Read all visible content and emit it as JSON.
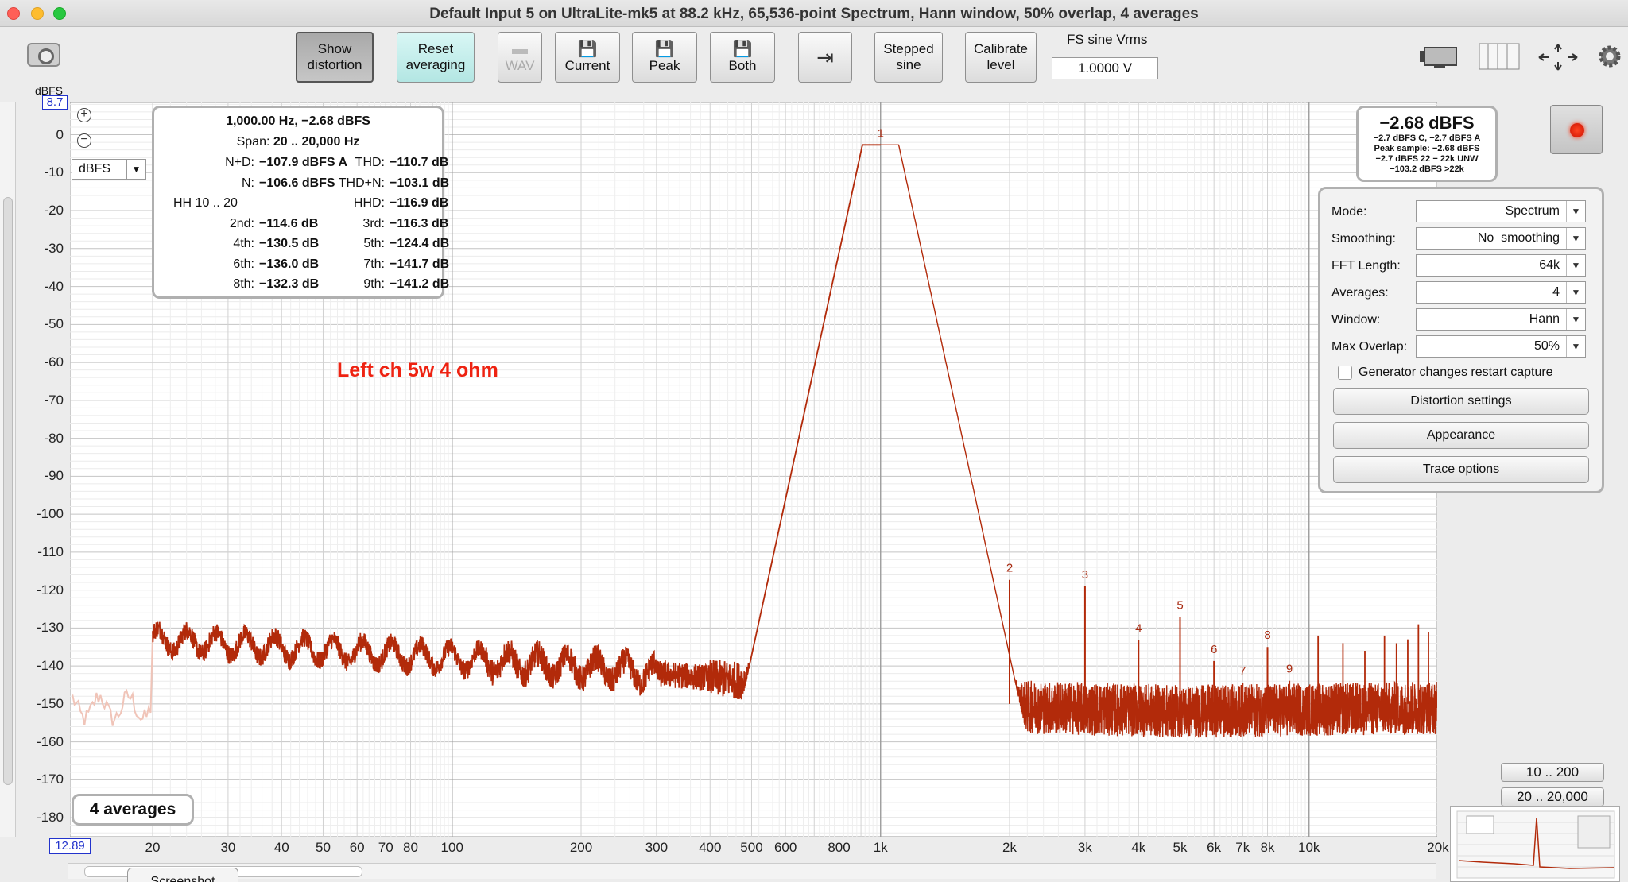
{
  "window": {
    "title": "Default Input 5 on UltraLite-mk5 at 88.2 kHz, 65,536-point Spectrum, Hann window, 50% overlap, 4 averages"
  },
  "toolbar": {
    "show_distortion": [
      "Show",
      "distortion"
    ],
    "reset_averaging": [
      "Reset",
      "averaging"
    ],
    "wav": "WAV",
    "current": "Current",
    "peak": "Peak",
    "both": "Both",
    "stepped_sine": [
      "Stepped",
      "sine"
    ],
    "calibrate_level": [
      "Calibrate",
      "level"
    ],
    "fs_label": "FS sine Vrms",
    "fs_value": "1.0000 V"
  },
  "axis": {
    "y_unit": "dBFS",
    "y_max": "8.7",
    "y_min_label": "12.89",
    "units_select": "dBFS",
    "y_ticks": [
      0,
      -10,
      -20,
      -30,
      -40,
      -50,
      -60,
      -70,
      -80,
      -90,
      -100,
      -110,
      -120,
      -130,
      -140,
      -150,
      -160,
      -170,
      -180
    ],
    "x_ticks": [
      {
        "f": 20,
        "label": "20"
      },
      {
        "f": 30,
        "label": "30"
      },
      {
        "f": 40,
        "label": "40"
      },
      {
        "f": 50,
        "label": "50"
      },
      {
        "f": 60,
        "label": "60"
      },
      {
        "f": 70,
        "label": "70"
      },
      {
        "f": 80,
        "label": "80"
      },
      {
        "f": 100,
        "label": "100"
      },
      {
        "f": 200,
        "label": "200"
      },
      {
        "f": 300,
        "label": "300"
      },
      {
        "f": 400,
        "label": "400"
      },
      {
        "f": 500,
        "label": "500"
      },
      {
        "f": 600,
        "label": "600"
      },
      {
        "f": 800,
        "label": "800"
      },
      {
        "f": 1000,
        "label": "1k"
      },
      {
        "f": 2000,
        "label": "2k"
      },
      {
        "f": 3000,
        "label": "3k"
      },
      {
        "f": 4000,
        "label": "4k"
      },
      {
        "f": 5000,
        "label": "5k"
      },
      {
        "f": 6000,
        "label": "6k"
      },
      {
        "f": 7000,
        "label": "7k"
      },
      {
        "f": 8000,
        "label": "8k"
      },
      {
        "f": 10000,
        "label": "10k"
      },
      {
        "f": 20000,
        "label": "20k"
      }
    ]
  },
  "distortion": {
    "header1": "1,000.00 Hz, −2.68 dBFS",
    "header2_prefix": "Span: ",
    "header2_value": "20 .. 20,000 Hz",
    "rows": [
      {
        "l_label": "N+D:",
        "l_value": "−107.9 dBFS A",
        "r_label": "THD:",
        "r_value": "−110.7 dB"
      },
      {
        "l_label": "N:",
        "l_value": "−106.6 dBFS",
        "r_label": "THD+N:",
        "r_value": "−103.1 dB"
      },
      {
        "l_label": "HH 10 .. 20",
        "l_value": "",
        "r_label": "HHD:",
        "r_value": "−116.9 dB"
      },
      {
        "l_label": "2nd:",
        "l_value": "−114.6 dB",
        "r_label": "3rd:",
        "r_value": "−116.3 dB"
      },
      {
        "l_label": "4th:",
        "l_value": "−130.5 dB",
        "r_label": "5th:",
        "r_value": "−124.4 dB"
      },
      {
        "l_label": "6th:",
        "l_value": "−136.0 dB",
        "r_label": "7th:",
        "r_value": "−141.7 dB"
      },
      {
        "l_label": "8th:",
        "l_value": "−132.3 dB",
        "r_label": "9th:",
        "r_value": "−141.2 dB"
      }
    ]
  },
  "annotation": "Left ch 5w 4 ohm",
  "level": {
    "big": "−2.68 dBFS",
    "lines": [
      "−2.7 dBFS C, −2.7 dBFS A",
      "Peak sample: −2.68 dBFS",
      "−2.7 dBFS 22 − 22k UNW",
      "−103.2 dBFS >22k"
    ]
  },
  "settings": {
    "mode_label": "Mode:",
    "mode_value": "Spectrum",
    "smoothing_label": "Smoothing:",
    "smoothing_value": "No  smoothing",
    "fft_label": "FFT Length:",
    "fft_value": "64k",
    "averages_label": "Averages:",
    "averages_value": "4",
    "window_label": "Window:",
    "window_value": "Hann",
    "overlap_label": "Max Overlap:",
    "overlap_value": "50%",
    "generator_label": "Generator changes restart capture",
    "distortion_settings": "Distortion settings",
    "appearance": "Appearance",
    "trace_options": "Trace options"
  },
  "averages_badge": "4 averages",
  "range_buttons": [
    "10 .. 200",
    "20 .. 20,000"
  ],
  "tab": "Screenshot",
  "colors": {
    "trace": "#b22a0a",
    "trace_faded": "#f0c4b8",
    "marker": "#a82a10"
  },
  "chart_data": {
    "type": "line",
    "x_scale": "log",
    "xlim": [
      20,
      20000
    ],
    "ylim": [
      -185,
      8.7
    ],
    "fundamental": {
      "freq": 1000,
      "level": -2.68
    },
    "harmonic_markers": [
      {
        "n": "1",
        "freq": 1000,
        "level": -2.68
      },
      {
        "n": "2",
        "freq": 2000,
        "level": -117.3
      },
      {
        "n": "3",
        "freq": 3000,
        "level": -119.0
      },
      {
        "n": "4",
        "freq": 4000,
        "level": -133.2
      },
      {
        "n": "5",
        "freq": 5000,
        "level": -127.1
      },
      {
        "n": "6",
        "freq": 6000,
        "level": -138.7
      },
      {
        "n": "7",
        "freq": 7000,
        "level": -144.4
      },
      {
        "n": "8",
        "freq": 8000,
        "level": -135.0
      },
      {
        "n": "9",
        "freq": 9000,
        "level": -143.9
      }
    ],
    "noise_floor": [
      [
        20,
        -133
      ],
      [
        100,
        -138
      ],
      [
        300,
        -142
      ],
      [
        800,
        -146
      ],
      [
        1200,
        -150
      ],
      [
        5000,
        -152
      ],
      [
        20000,
        -151
      ]
    ]
  }
}
